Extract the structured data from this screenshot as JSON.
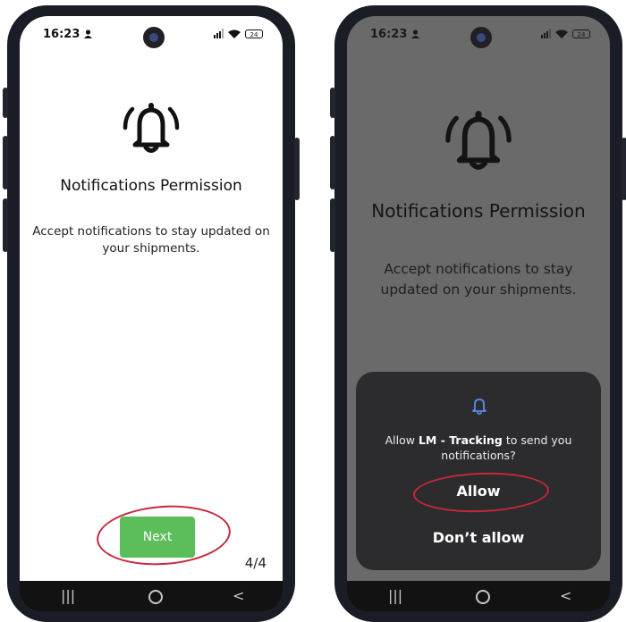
{
  "status_bar": {
    "time": "16:23",
    "battery": "24"
  },
  "onboarding": {
    "title": "Notifications Permission",
    "description": "Accept notifications to stay updated on your shipments.",
    "next_label": "Next",
    "page_indicator": "4/4"
  },
  "permission_dialog": {
    "message_prefix": "Allow ",
    "app_name": "LM - Tracking",
    "message_suffix": " to send you notifications?",
    "allow_label": "Allow",
    "deny_label": "Don’t allow"
  },
  "nav_bar": {
    "recents": "|||",
    "home": "O",
    "back": "<"
  },
  "colors": {
    "accent_green": "#5cbe5a",
    "highlight_red": "#c6283b",
    "dialog_bg": "#2c2c2e",
    "dialog_icon": "#5b8def"
  }
}
